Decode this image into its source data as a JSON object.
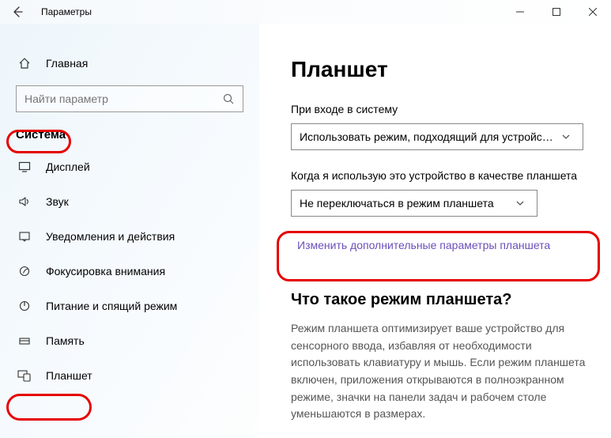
{
  "window": {
    "title": "Параметры"
  },
  "sidebar": {
    "home": "Главная",
    "search_placeholder": "Найти параметр",
    "section": "Система",
    "items": [
      {
        "label": "Дисплей"
      },
      {
        "label": "Звук"
      },
      {
        "label": "Уведомления и действия"
      },
      {
        "label": "Фокусировка внимания"
      },
      {
        "label": "Питание и спящий режим"
      },
      {
        "label": "Память"
      },
      {
        "label": "Планшет"
      }
    ]
  },
  "main": {
    "heading": "Планшет",
    "field1_label": "При входе в систему",
    "field1_value": "Использовать режим, подходящий для устройства",
    "field2_label": "Когда я использую это устройство в качестве планшета",
    "field2_value": "Не переключаться в режим планшета",
    "link": "Изменить дополнительные параметры планшета",
    "sub_heading": "Что такое режим планшета?",
    "description": "Режим планшета оптимизирует ваше устройство для сенсорного ввода, избавляя от необходимости использовать клавиатуру и мышь. Если режим планшета включен, приложения открываются в полноэкранном режиме, значки на панели задач и рабочем столе уменьшаются в размерах."
  }
}
